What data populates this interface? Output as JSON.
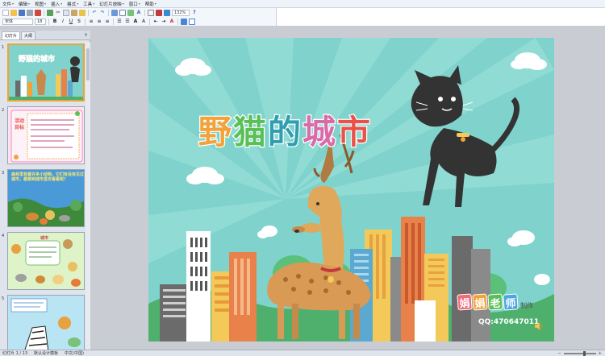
{
  "menus": [
    {
      "key": "file-menu",
      "label": "文件"
    },
    {
      "key": "edit-menu",
      "label": "编辑"
    },
    {
      "key": "view-menu",
      "label": "视图"
    },
    {
      "key": "insert-menu",
      "label": "插入"
    },
    {
      "key": "format-menu",
      "label": "格式"
    },
    {
      "key": "tools-menu",
      "label": "工具"
    },
    {
      "key": "slideshow-menu",
      "label": "幻灯片放映"
    },
    {
      "key": "window-menu",
      "label": "窗口"
    },
    {
      "key": "help-menu",
      "label": "帮助"
    }
  ],
  "toolbar": {
    "font_name": "宋体",
    "font_size": "18",
    "zoom": "132%"
  },
  "panel": {
    "tabs": [
      "幻灯片",
      "大纲"
    ],
    "close_icon": "close-icon"
  },
  "slides": [
    {
      "number": "1",
      "title": "野猫的城市",
      "active": true
    },
    {
      "number": "2",
      "title": "活动目标",
      "active": false
    },
    {
      "number": "3",
      "title": "森林里有着许多小动物，它们有没有见过城市，都想到城市里去看看呢？",
      "active": false
    },
    {
      "number": "4",
      "title": "城市",
      "active": false
    },
    {
      "number": "5",
      "title": "",
      "active": false
    }
  ],
  "main_slide": {
    "title_chars": [
      {
        "char": "野",
        "color": "#f3a23a"
      },
      {
        "char": "猫",
        "color": "#5bbf57"
      },
      {
        "char": "的",
        "color": "#2f9fb0"
      },
      {
        "char": "城",
        "color": "#d96ba8"
      },
      {
        "char": "市",
        "color": "#e9524a"
      }
    ],
    "brand_chars": [
      {
        "char": "娟",
        "color": "#f06a7a"
      },
      {
        "char": "娟",
        "color": "#f3a23a"
      },
      {
        "char": "老",
        "color": "#5bbf57"
      },
      {
        "char": "师",
        "color": "#4aa6e0"
      }
    ],
    "brand_suffix": "制作",
    "brand_qq": "QQ:470647011",
    "speaker_icon": "speaker-icon"
  },
  "status": {
    "slide_info": "幻灯片 1 / 13",
    "template": "默认设计模板",
    "language": "中文(中国)"
  }
}
